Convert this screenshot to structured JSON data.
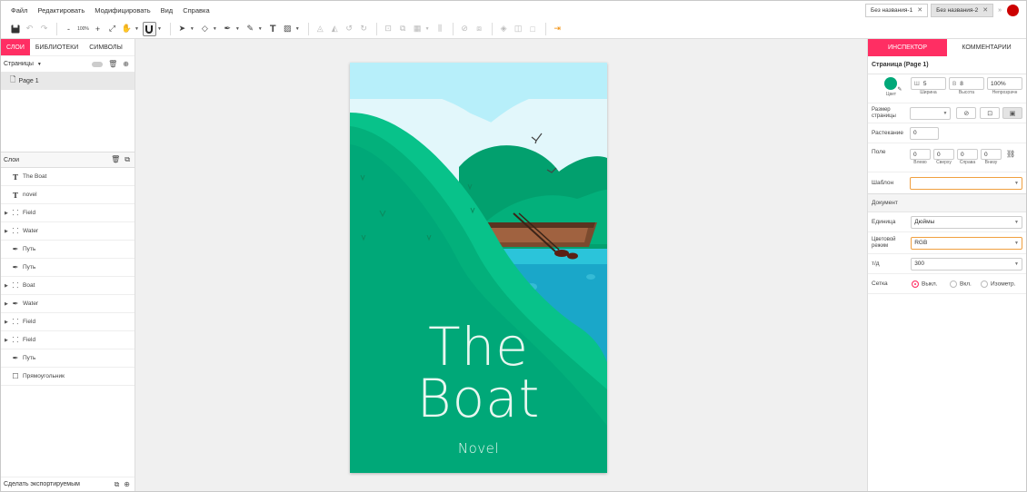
{
  "menu": [
    "Файл",
    "Редактировать",
    "Модифицировать",
    "Вид",
    "Справка"
  ],
  "doc_tabs": [
    {
      "label": "Без названия-1",
      "active": false
    },
    {
      "label": "Без названия-2",
      "active": true
    }
  ],
  "toolbar": {
    "zoom": "100%"
  },
  "left_panel": {
    "tabs": [
      "СЛОИ",
      "БИБЛИОТЕКИ",
      "СИМВОЛЫ"
    ],
    "pages_label": "Страницы",
    "pages": [
      "Page 1"
    ],
    "layers_label": "Слои",
    "layers": [
      {
        "name": "The Boat",
        "icon": "text-icon",
        "group": false
      },
      {
        "name": "novel",
        "icon": "text-icon",
        "group": false
      },
      {
        "name": "Field",
        "icon": "group-icon",
        "group": true
      },
      {
        "name": "Water",
        "icon": "group-icon",
        "group": true
      },
      {
        "name": "Путь",
        "icon": "pen-icon",
        "group": false
      },
      {
        "name": "Путь",
        "icon": "pen-icon",
        "group": false
      },
      {
        "name": "Boat",
        "icon": "group-icon",
        "group": true
      },
      {
        "name": "Water",
        "icon": "pen-icon",
        "group": true
      },
      {
        "name": "Field",
        "icon": "group-icon",
        "group": true
      },
      {
        "name": "Field",
        "icon": "group-icon",
        "group": true
      },
      {
        "name": "Путь",
        "icon": "pen-icon",
        "group": false
      },
      {
        "name": "Прямоугольник",
        "icon": "rect-icon",
        "group": false
      }
    ],
    "export_label": "Сделать экспортируемым"
  },
  "artboard": {
    "title_line1": "The",
    "title_line2": "Boat",
    "subtitle": "Novel"
  },
  "inspector": {
    "tabs": [
      "ИНСПЕКТОР",
      "КОММЕНТАРИИ"
    ],
    "page_section": "Страница (Page 1)",
    "color_label": "Цвет",
    "accent_color": "#00a878",
    "width_prefix": "Ш",
    "width_value": "5",
    "width_label": "Ширина",
    "height_prefix": "В",
    "height_value": "8",
    "height_label": "Высота",
    "opacity_value": "100%",
    "opacity_label": "Непрозрачн",
    "page_size_label": "Размер страницы",
    "rasterize_label": "Растекание",
    "rasterize_value": "0",
    "margin_label": "Поле",
    "margins": [
      {
        "value": "0",
        "label": "Влево"
      },
      {
        "value": "0",
        "label": "Сверху"
      },
      {
        "value": "0",
        "label": "Справа"
      },
      {
        "value": "0",
        "label": "Внизу"
      }
    ],
    "template_label": "Шаблон",
    "document_section": "Документ",
    "units_label": "Единица",
    "units_value": "Дюймы",
    "color_mode_label": "Цветовой режим",
    "color_mode_value": "RGB",
    "dpi_label": "т/д",
    "dpi_value": "300",
    "grid_label": "Сетка",
    "grid_options": [
      "Выкл.",
      "Вкл.",
      "Изометр."
    ]
  }
}
